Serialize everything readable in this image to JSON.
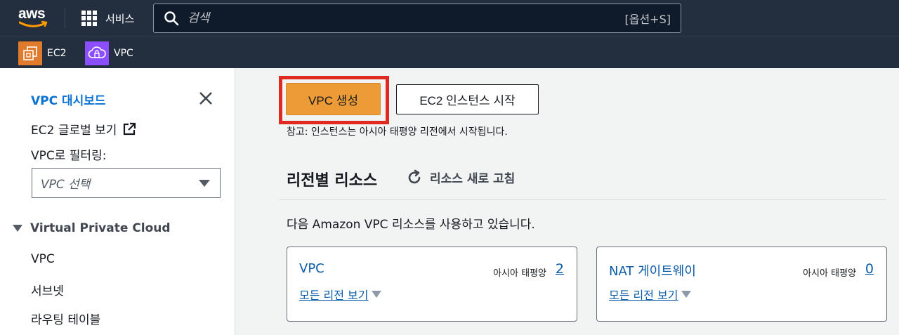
{
  "nav": {
    "logo_text": "aws",
    "services_label": "서비스",
    "search_placeholder": "검색",
    "search_shortcut": "[옵션+S]",
    "favorites": [
      {
        "label": "EC2",
        "icon": "ec2-icon",
        "color": "#e07b2b"
      },
      {
        "label": "VPC",
        "icon": "vpc-icon",
        "color": "#8c4fff"
      }
    ]
  },
  "sidebar": {
    "title": "VPC 대시보드",
    "ec2_global": "EC2 글로벌 보기",
    "filter_label": "VPC로 필터링:",
    "select_placeholder": "VPC 선택",
    "section_title": "Virtual Private Cloud",
    "links": [
      "VPC",
      "서브넷",
      "라우팅 테이블"
    ]
  },
  "main": {
    "create_button": "VPC 생성",
    "ec2_button": "EC2 인스턴스 시작",
    "note": "참고: 인스턴스는 아시아 태평양 리전에서 시작됩니다.",
    "resources_title": "리전별 리소스",
    "refresh_label": "리소스 새로 고침",
    "using_text": "다음 Amazon VPC 리소스를 사용하고 있습니다.",
    "cards": [
      {
        "name": "VPC",
        "region": "아시아 태평양",
        "count": "2",
        "all_regions": "모든 리전 보기"
      },
      {
        "name": "NAT 게이트웨이",
        "region": "아시아 태평양",
        "count": "0",
        "all_regions": "모든 리전 보기"
      }
    ]
  },
  "colors": {
    "nav_bg": "#232f3e",
    "accent": "#ec9b36",
    "link": "#0972d3",
    "highlight": "#e02a1f"
  }
}
